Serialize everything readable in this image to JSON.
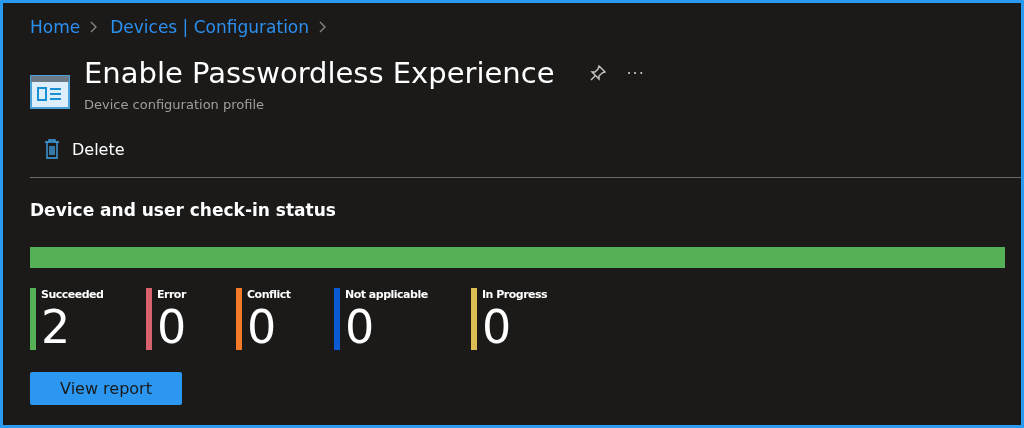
{
  "breadcrumb": [
    "Home",
    "Devices | Configuration"
  ],
  "header": {
    "title": "Enable Passwordless Experience",
    "subtitle": "Device configuration profile",
    "more": "···"
  },
  "toolbar": [
    {
      "label": "Delete"
    }
  ],
  "status": {
    "heading": "Device and user check-in status",
    "level": 1,
    "items": [
      {
        "label": "Succeeded",
        "count": "2",
        "color": "#55b155"
      },
      {
        "label": "Error",
        "count": "0",
        "color": "#d8636d"
      },
      {
        "label": "Conflict",
        "count": "0",
        "color": "#f47a2a"
      },
      {
        "label": "Not applicable",
        "count": "0",
        "color": "#0a5ad4"
      },
      {
        "label": "In Progress",
        "count": "0",
        "color": "#dbbd53"
      }
    ]
  },
  "buttons": [
    "View report"
  ]
}
